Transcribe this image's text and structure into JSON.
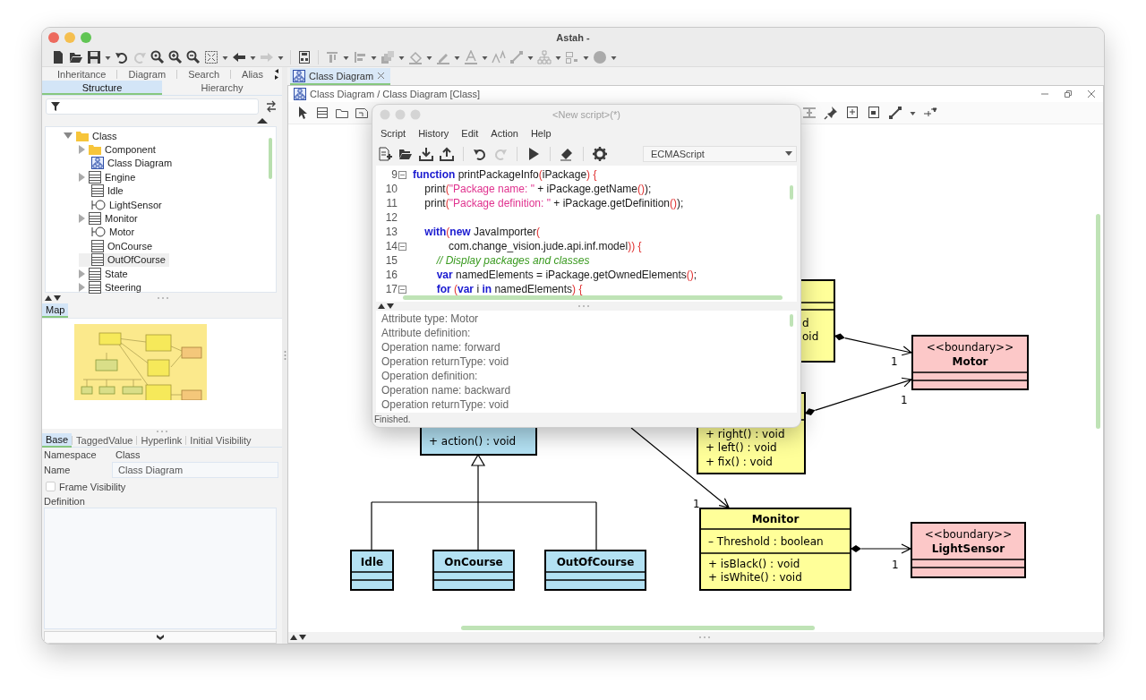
{
  "window": {
    "title": "Astah -"
  },
  "explorer": {
    "tab_rows": [
      [
        {
          "label": "Inheritance",
          "selected": false
        },
        {
          "label": "Diagram",
          "selected": false
        },
        {
          "label": "Search",
          "selected": false
        },
        {
          "label": "Alias",
          "selected": false
        }
      ],
      [
        {
          "label": "Structure",
          "selected": true
        },
        {
          "label": "Hierarchy",
          "selected": false
        }
      ]
    ],
    "tree": [
      {
        "label": "Class",
        "kind": "folder",
        "expandable": true,
        "expanded": true,
        "selected": false,
        "children": [
          {
            "label": "Component",
            "kind": "folder",
            "expandable": true,
            "expanded": false,
            "selected": false
          },
          {
            "label": "Class Diagram",
            "kind": "diagram",
            "expandable": false,
            "selected": false
          },
          {
            "label": "Engine",
            "kind": "class",
            "expandable": true,
            "expanded": false,
            "selected": false
          },
          {
            "label": "Idle",
            "kind": "class",
            "expandable": false,
            "selected": false
          },
          {
            "label": "LightSensor",
            "kind": "boundary",
            "expandable": false,
            "selected": false
          },
          {
            "label": "Monitor",
            "kind": "class",
            "expandable": true,
            "expanded": false,
            "selected": false
          },
          {
            "label": "Motor",
            "kind": "boundary",
            "expandable": false,
            "selected": false
          },
          {
            "label": "OnCourse",
            "kind": "class",
            "expandable": false,
            "selected": false
          },
          {
            "label": "OutOfCourse",
            "kind": "class",
            "expandable": false,
            "selected": true
          },
          {
            "label": "State",
            "kind": "class",
            "expandable": true,
            "expanded": false,
            "selected": false
          },
          {
            "label": "Steering",
            "kind": "class",
            "expandable": true,
            "expanded": false,
            "selected": false
          }
        ]
      }
    ]
  },
  "map": {
    "tab": {
      "label": "Map",
      "selected": true
    }
  },
  "properties": {
    "tabs": [
      {
        "label": "Base",
        "selected": true
      },
      {
        "label": "TaggedValue",
        "selected": false
      },
      {
        "label": "Hyperlink",
        "selected": false
      },
      {
        "label": "Initial Visibility",
        "selected": false
      }
    ],
    "namespace_label": "Namespace",
    "namespace": "Class",
    "name_label": "Name",
    "name": "Class Diagram",
    "frame_visibility": {
      "label": "Frame Visibility",
      "checked": false
    },
    "definition_label": "Definition"
  },
  "editor": {
    "tabs": [
      {
        "label": "Class Diagram",
        "selected": true
      }
    ],
    "breadcrumb": "Class Diagram / Class Diagram [Class]",
    "classes": [
      {
        "color": "#ffff99",
        "operations": [
          "d",
          "oid"
        ]
      },
      {
        "color": "#fcc8c8",
        "stereotype": "<<boundary>>",
        "name": "Motor"
      },
      {
        "color": "#ffff99",
        "operations": [
          "+ right() : void",
          "+ left() : void",
          "+ fix() : void"
        ]
      },
      {
        "color": "#b3e1f3",
        "operations": [
          "+ action() : void"
        ]
      },
      {
        "color": "#ffff99",
        "name": "Monitor",
        "attributes": [
          "– Threshold : boolean"
        ],
        "operations": [
          "+ isBlack() : void",
          "+ isWhite() : void"
        ]
      },
      {
        "color": "#fcc8c8",
        "stereotype": "<<boundary>>",
        "name": "LightSensor"
      },
      {
        "color": "#b3e1f3",
        "name": "Idle"
      },
      {
        "color": "#b3e1f3",
        "name": "OnCourse"
      },
      {
        "color": "#b3e1f3",
        "name": "OutOfCourse"
      }
    ],
    "edges": [
      {
        "kind": "composition",
        "multiplicity": "1"
      },
      {
        "kind": "composition",
        "multiplicity": "1"
      },
      {
        "kind": "composition",
        "multiplicity": "1"
      },
      {
        "kind": "association",
        "multiplicity": "1"
      },
      {
        "kind": "generalization"
      }
    ]
  },
  "script_window": {
    "title": "<New script>(*)",
    "menu": [
      "Script",
      "History",
      "Edit",
      "Action",
      "Help"
    ],
    "language": "ECMAScript",
    "code": [
      {
        "number": "9",
        "foldable": true,
        "tokens": [
          {
            "kind": "keyword",
            "text": "function"
          },
          {
            "kind": "plain",
            "text": " printPackageInfo"
          },
          {
            "kind": "bracket",
            "text": "("
          },
          {
            "kind": "plain",
            "text": "iPackage"
          },
          {
            "kind": "bracket",
            "text": ") {"
          }
        ]
      },
      {
        "number": "10",
        "foldable": false,
        "tokens": [
          {
            "kind": "plain",
            "text": "    print"
          },
          {
            "kind": "bracket",
            "text": "("
          },
          {
            "kind": "string",
            "text": "\"Package name: \""
          },
          {
            "kind": "plain",
            "text": " + iPackage.getName"
          },
          {
            "kind": "bracket",
            "text": "()"
          },
          {
            "kind": "plain",
            "text": ");"
          }
        ]
      },
      {
        "number": "11",
        "foldable": false,
        "tokens": [
          {
            "kind": "plain",
            "text": "    print"
          },
          {
            "kind": "bracket",
            "text": "("
          },
          {
            "kind": "string",
            "text": "\"Package definition: \""
          },
          {
            "kind": "plain",
            "text": " + iPackage.getDefinition"
          },
          {
            "kind": "bracket",
            "text": "()"
          },
          {
            "kind": "plain",
            "text": ");"
          }
        ]
      },
      {
        "number": "12",
        "foldable": false
      },
      {
        "number": "13",
        "foldable": false,
        "tokens": [
          {
            "kind": "keyword",
            "text": "    with"
          },
          {
            "kind": "bracket",
            "text": "("
          },
          {
            "kind": "keyword",
            "text": "new"
          },
          {
            "kind": "plain",
            "text": " JavaImporter"
          },
          {
            "kind": "bracket",
            "text": "("
          }
        ]
      },
      {
        "number": "14",
        "foldable": true,
        "tokens": [
          {
            "kind": "plain",
            "text": "            com.change_vision.jude.api.inf.model"
          },
          {
            "kind": "bracket",
            "text": ")) {"
          }
        ]
      },
      {
        "number": "15",
        "foldable": false,
        "tokens": [
          {
            "kind": "comment",
            "text": "        // Display packages and classes"
          }
        ]
      },
      {
        "number": "16",
        "foldable": false,
        "tokens": [
          {
            "kind": "keyword",
            "text": "        var"
          },
          {
            "kind": "plain",
            "text": " namedElements = iPackage.getOwnedElements"
          },
          {
            "kind": "bracket",
            "text": "()"
          },
          {
            "kind": "plain",
            "text": ";"
          }
        ]
      },
      {
        "number": "17",
        "foldable": true,
        "tokens": [
          {
            "kind": "keyword",
            "text": "        for"
          },
          {
            "kind": "bracket",
            "text": " ("
          },
          {
            "kind": "keyword",
            "text": "var"
          },
          {
            "kind": "plain",
            "text": " i "
          },
          {
            "kind": "keyword",
            "text": "in"
          },
          {
            "kind": "plain",
            "text": " namedElements"
          },
          {
            "kind": "bracket",
            "text": ") {"
          }
        ]
      }
    ],
    "output": [
      "Attribute type: Motor",
      "Attribute definition:",
      "Operation name: forward",
      "Operation returnType: void",
      "Operation definition:",
      "Operation name: backward",
      "Operation returnType: void"
    ],
    "status": "Finished."
  }
}
